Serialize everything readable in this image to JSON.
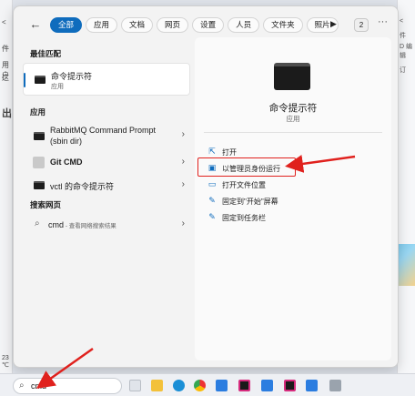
{
  "background": {
    "left_fragments": [
      "<",
      "件",
      "用户",
      "这",
      "出"
    ],
    "right_fragments": [
      "<",
      "件",
      "D 编辑",
      "订"
    ],
    "bottom_left": "23 ℃"
  },
  "panel": {
    "back_glyph": "←",
    "tabs": [
      "全部",
      "应用",
      "文档",
      "网页",
      "设置",
      "人员",
      "文件夹",
      "照片"
    ],
    "play_glyph": "▶",
    "badge": "2",
    "more_glyph": "···"
  },
  "left": {
    "best_match_header": "最佳匹配",
    "best_match": {
      "title": "命令提示符",
      "subtitle": "应用"
    },
    "apps_header": "应用",
    "apps": [
      {
        "line1": "RabbitMQ Command Prompt",
        "line2": "(sbin dir)",
        "icon": "cmd-icon"
      },
      {
        "line1": "Git CMD",
        "icon": "git-icon"
      },
      {
        "line1": "vctl 的命令提示符",
        "icon": "cmd-icon"
      }
    ],
    "web_header": "搜索网页",
    "web_query": "cmd",
    "web_hint": " - 查看网络搜索结果",
    "chevron": "›"
  },
  "detail": {
    "title": "命令提示符",
    "subtitle": "应用",
    "actions": [
      {
        "label": "打开",
        "icon": "open-icon",
        "glyph": "⇱"
      },
      {
        "label": "以管理员身份运行",
        "icon": "admin-shield-icon",
        "glyph": "▣"
      },
      {
        "label": "打开文件位置",
        "icon": "folder-icon",
        "glyph": "▭"
      },
      {
        "label": "固定到\"开始\"屏幕",
        "icon": "pin-icon",
        "glyph": "✎"
      },
      {
        "label": "固定到任务栏",
        "icon": "pin-taskbar-icon",
        "glyph": "✎"
      }
    ]
  },
  "taskbar": {
    "search_value": "cmd",
    "search_glyph": "⌕"
  },
  "side_tile_text": "笑",
  "colors": {
    "accent": "#0f6cbd",
    "annotation_red": "#e0211d"
  }
}
